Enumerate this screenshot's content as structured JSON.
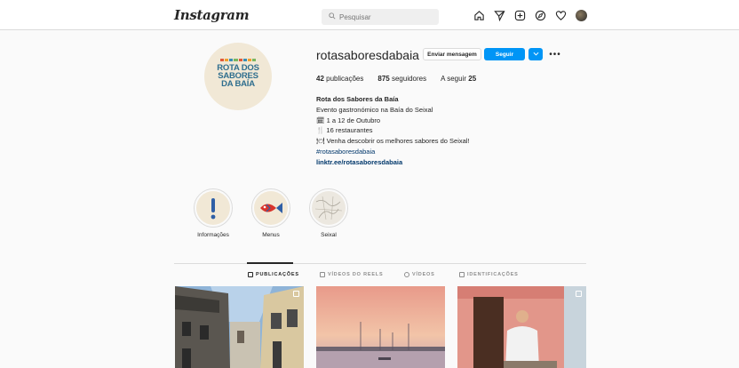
{
  "header": {
    "logo": "Instagram",
    "search_placeholder": "Pesquisar"
  },
  "profile": {
    "username": "rotasaboresdabaia",
    "pic_text": [
      "ROTA DOS",
      "SABORES",
      "DA BAÍA"
    ],
    "buttons": {
      "message": "Enviar mensagem",
      "follow": "Seguir",
      "more": "•••"
    },
    "stats": {
      "posts_count": "42",
      "posts_label": " publicações",
      "followers_count": "875",
      "followers_label": " seguidores",
      "following_label": "A seguir ",
      "following_count": "25"
    },
    "bio": {
      "name": "Rota dos Sabores da Baía",
      "line1": "Evento gastronómico na Baía do Seixal",
      "line2": "🗓 1 a 12 de Outubro",
      "line3": "🍴 16 restaurantes",
      "line4": "🍽 Venha descobrir os melhores sabores do Seixal!",
      "hashtag": "#rotasaboresdabaia",
      "link": "linktr.ee/rotasaboresdabaia"
    }
  },
  "highlights": [
    {
      "label": "Informações"
    },
    {
      "label": "Menus"
    },
    {
      "label": "Seixal"
    }
  ],
  "tabs": [
    {
      "label": "PUBLICAÇÕES",
      "active": true
    },
    {
      "label": "VÍDEOS DO REELS",
      "active": false
    },
    {
      "label": "VÍDEOS",
      "active": false
    },
    {
      "label": "IDENTIFICAÇÕES",
      "active": false
    }
  ],
  "colors": {
    "accent": "#0095f6",
    "brand_blue": "#2f6e8e",
    "link": "#00376b"
  }
}
